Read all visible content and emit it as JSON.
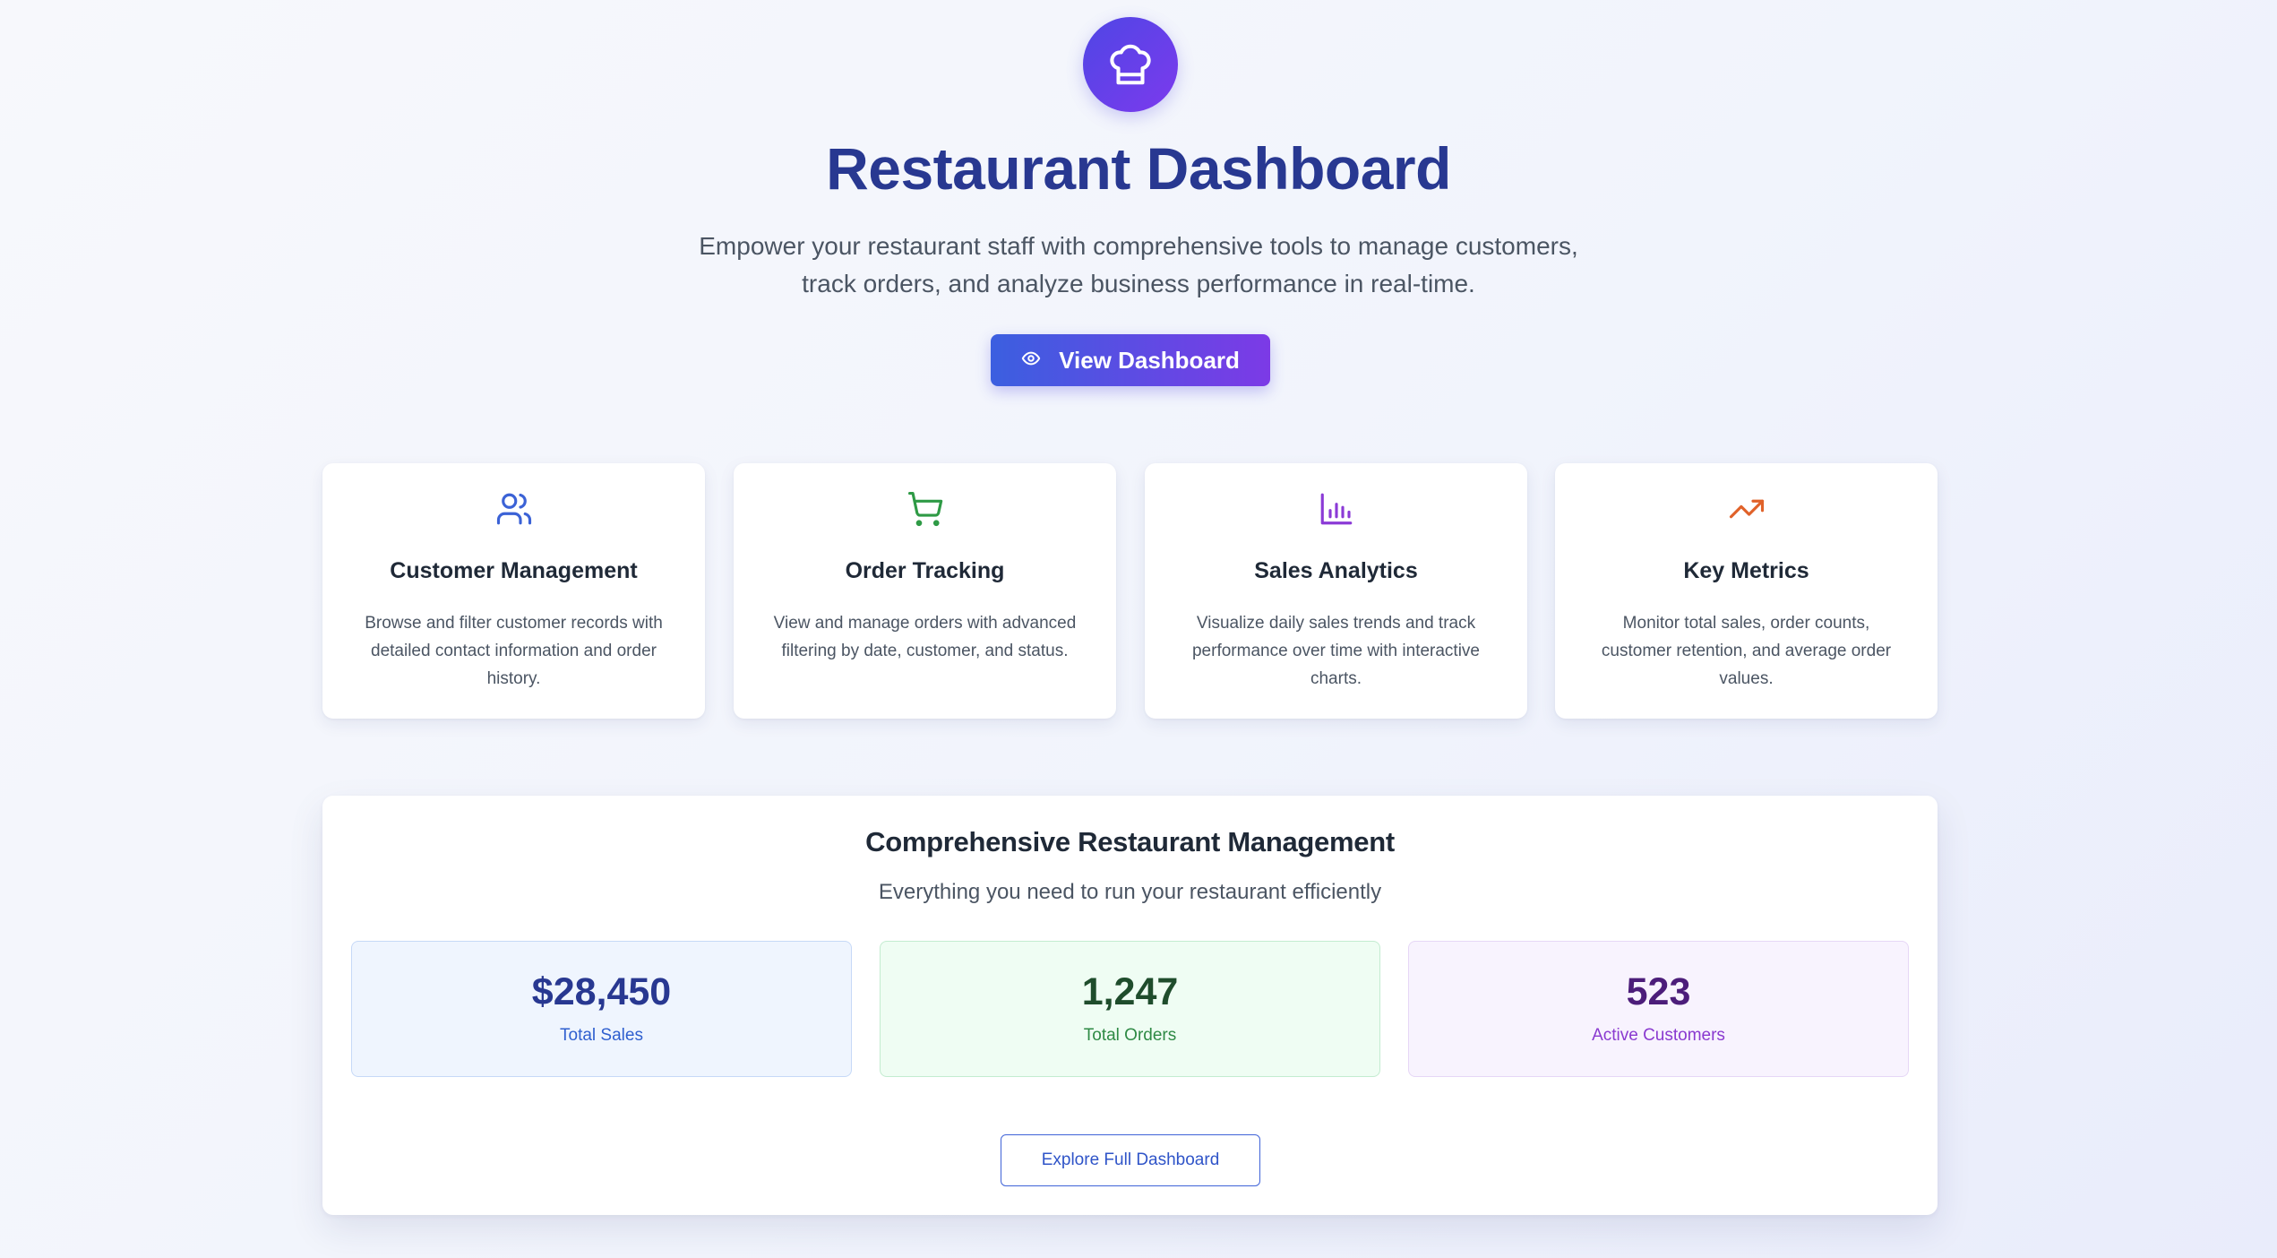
{
  "hero": {
    "logo_icon": "chef-hat-icon",
    "title": "Restaurant Dashboard",
    "subtitle": "Empower your restaurant staff with comprehensive tools to manage customers, track orders, and analyze business performance in real-time.",
    "cta": {
      "label": "View Dashboard",
      "icon": "eye-icon"
    }
  },
  "features": [
    {
      "icon": "users-icon",
      "color": "#3b62d6",
      "title": "Customer Management",
      "description": "Browse and filter customer records with detailed contact information and order history."
    },
    {
      "icon": "shopping-cart-icon",
      "color": "#2e9a45",
      "title": "Order Tracking",
      "description": "View and manage orders with advanced filtering by date, customer, and status."
    },
    {
      "icon": "bar-chart-icon",
      "color": "#8b3ad6",
      "title": "Sales Analytics",
      "description": "Visualize daily sales trends and track performance over time with interactive charts."
    },
    {
      "icon": "trending-up-icon",
      "color": "#e0622a",
      "title": "Key Metrics",
      "description": "Monitor total sales, order counts, customer retention, and average order values."
    }
  ],
  "overview": {
    "title": "Comprehensive Restaurant Management",
    "subtitle": "Everything you need to run your restaurant efficiently",
    "stats": [
      {
        "value": "$28,450",
        "label": "Total Sales"
      },
      {
        "value": "1,247",
        "label": "Total Orders"
      },
      {
        "value": "523",
        "label": "Active Customers"
      }
    ],
    "button_label": "Explore Full Dashboard"
  }
}
